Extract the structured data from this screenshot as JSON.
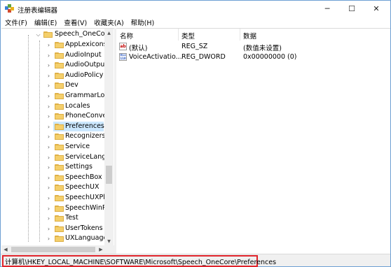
{
  "window": {
    "title": "注册表编辑器",
    "icon": "regedit-icon",
    "controls": {
      "minimize": "─",
      "maximize": "☐",
      "close": "✕"
    }
  },
  "menu": [
    "文件(F)",
    "编辑(E)",
    "查看(V)",
    "收藏夹(A)",
    "帮助(H)"
  ],
  "tree": {
    "parent": "Speech_OneCore",
    "children": [
      {
        "label": "AppLexicons",
        "selected": false
      },
      {
        "label": "AudioInput",
        "selected": false
      },
      {
        "label": "AudioOutput",
        "selected": false
      },
      {
        "label": "AudioPolicy",
        "selected": false
      },
      {
        "label": "Dev",
        "selected": false
      },
      {
        "label": "GrammarLog",
        "selected": false
      },
      {
        "label": "Locales",
        "selected": false
      },
      {
        "label": "PhoneConver",
        "selected": false
      },
      {
        "label": "Preferences",
        "selected": true
      },
      {
        "label": "Recognizers",
        "selected": false
      },
      {
        "label": "Service",
        "selected": false
      },
      {
        "label": "ServiceLangu",
        "selected": false
      },
      {
        "label": "Settings",
        "selected": false
      },
      {
        "label": "SpeechBox",
        "selected": false
      },
      {
        "label": "SpeechUX",
        "selected": false
      },
      {
        "label": "SpeechUXPlu",
        "selected": false
      },
      {
        "label": "SpeechWinRT",
        "selected": false
      },
      {
        "label": "Test",
        "selected": false
      },
      {
        "label": "UserTokens",
        "selected": false
      },
      {
        "label": "UXLanguages",
        "selected": false
      }
    ]
  },
  "columns": {
    "name": "名称",
    "type": "类型",
    "data": "数据"
  },
  "values": [
    {
      "icon": "string-value-icon",
      "icon_glyph": "ab",
      "name": "(默认)",
      "type": "REG_SZ",
      "data": "(数值未设置)"
    },
    {
      "icon": "binary-value-icon",
      "icon_glyph": "011 110",
      "name": "VoiceActivatio...",
      "type": "REG_DWORD",
      "data": "0x00000000 (0)"
    }
  ],
  "status": {
    "path": "计算机\\HKEY_LOCAL_MACHINE\\SOFTWARE\\Microsoft\\Speech_OneCore\\Preferences",
    "highlight_color": "#e0242b"
  },
  "colors": {
    "selection": "#cce8ff",
    "folder": "#f4cf6b",
    "window_border": "#6d9fd3"
  }
}
